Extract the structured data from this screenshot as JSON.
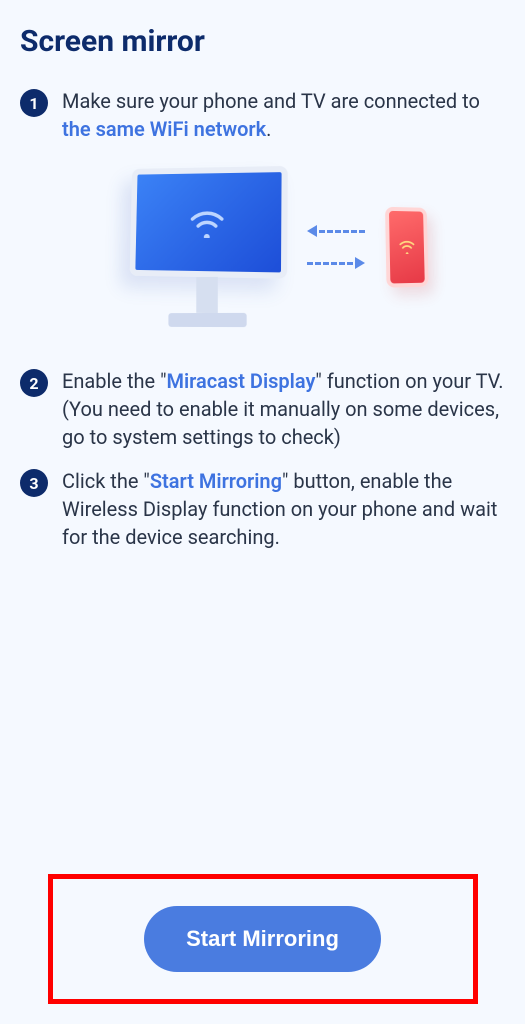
{
  "title": "Screen mirror",
  "steps": [
    {
      "num": "1",
      "pre": "Make sure your phone and TV are connected to ",
      "highlight": "the same WiFi network",
      "post": "."
    },
    {
      "num": "2",
      "pre": "Enable the \"",
      "highlight": "Miracast Display",
      "post": "\" function on your TV.(You need to enable it manually on some devices, go to system settings to check)"
    },
    {
      "num": "3",
      "pre": "Click the \"",
      "highlight": "Start Mirroring",
      "post": "\" button, enable the Wireless Display function on your phone and wait for the device searching."
    }
  ],
  "button_label": "Start Mirroring"
}
